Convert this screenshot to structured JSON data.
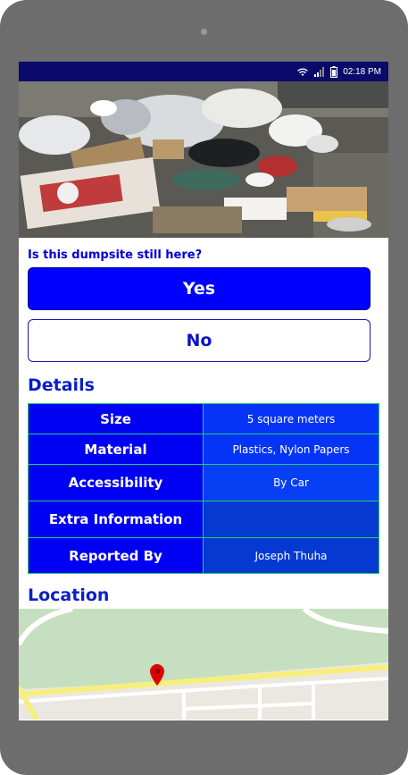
{
  "status_bar": {
    "time": "02:18 PM"
  },
  "question": "Is this dumpsite still here?",
  "buttons": {
    "yes": "Yes",
    "no": "No"
  },
  "details": {
    "title": "Details",
    "rows": [
      {
        "label": "Size",
        "value": "5 square meters"
      },
      {
        "label": "Material",
        "value": "Plastics, Nylon Papers"
      },
      {
        "label": "Accessibility",
        "value": "By Car"
      },
      {
        "label": "Extra Information",
        "value": ""
      },
      {
        "label": "Reported By",
        "value": "Joseph Thuha"
      }
    ]
  },
  "location": {
    "title": "Location"
  },
  "colors": {
    "primary": "#0000ff",
    "heading": "#0b1fc4",
    "table_border": "#1bd16a",
    "status_bar": "#0a0a6b",
    "map_pin": "#e00000"
  }
}
